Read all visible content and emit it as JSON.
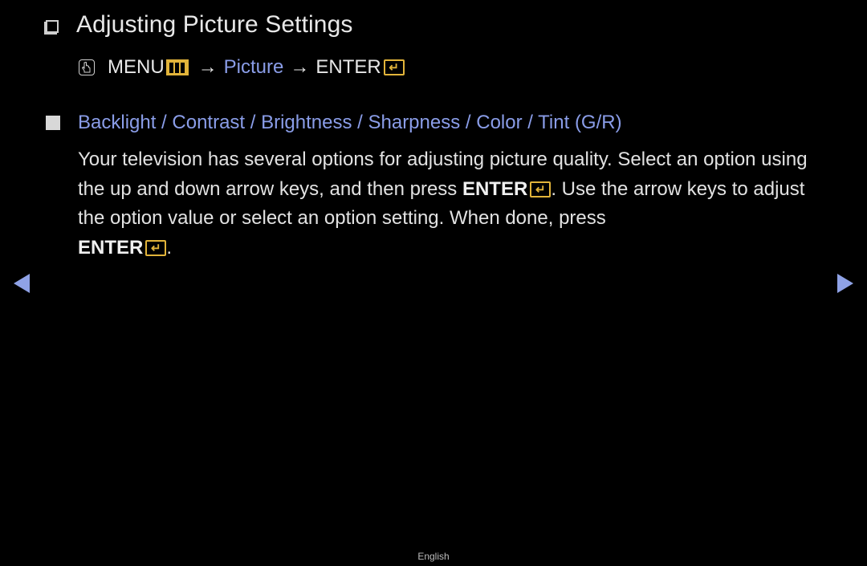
{
  "header": {
    "title": "Adjusting Picture Settings",
    "title_icon": "checkbox-outline-icon"
  },
  "menu_path": {
    "touch_icon": "hand-pointer-icon",
    "menu_label": "MENU",
    "menu_icon": "menu-grid-icon",
    "arrow_1": "→",
    "picture_label": "Picture",
    "arrow_2": "→",
    "enter_label": "ENTER",
    "enter_icon": "enter-return-icon"
  },
  "section": {
    "bullet_icon": "filled-square-icon",
    "title": "Backlight / Contrast / Brightness / Sharpness / Color / Tint (G/R)",
    "body_part1": "Your television has several options for adjusting picture quality. Select an option using the up and down arrow keys, and then press ",
    "body_enter_1": "ENTER",
    "body_part2": ". Use the arrow keys to adjust the option value or select an option setting. When done, press ",
    "body_enter_2": "ENTER",
    "body_part3": "."
  },
  "navigation": {
    "prev_icon": "triangle-left-icon",
    "next_icon": "triangle-right-icon"
  },
  "footer": {
    "language": "English"
  },
  "colors": {
    "background": "#000000",
    "accent_blue": "#8a9de8",
    "icon_gold": "#e2b43a",
    "text": "#e6e6e6"
  }
}
